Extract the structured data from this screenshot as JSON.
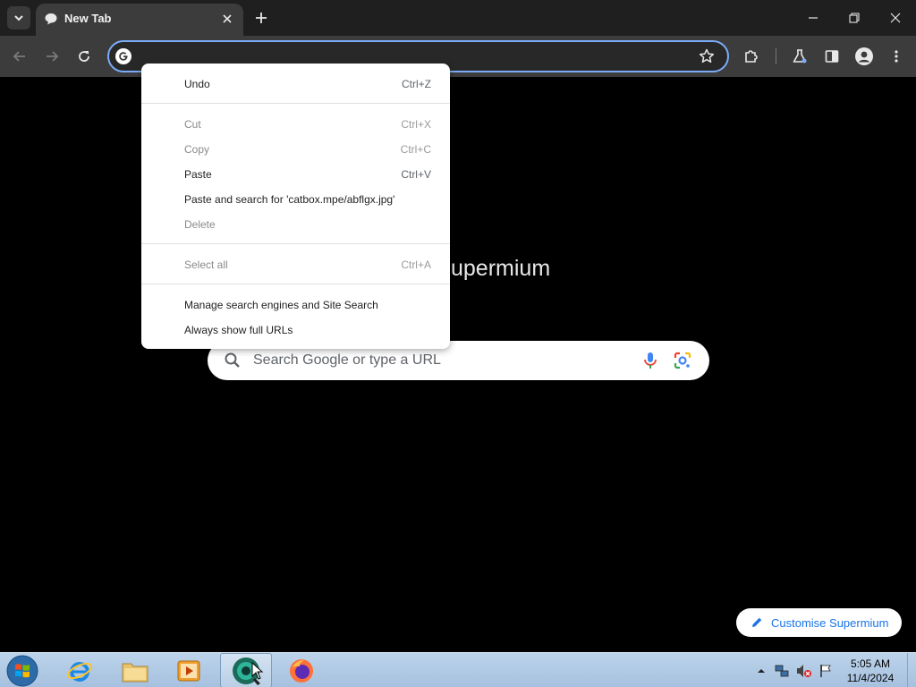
{
  "browser": {
    "tab": {
      "title": "New Tab"
    },
    "omnibox": {
      "value": ""
    }
  },
  "page": {
    "brand_text_visible": "upermium",
    "search": {
      "placeholder": "Search Google or type a URL"
    },
    "customise_label": "Customise Supermium"
  },
  "context_menu": {
    "items": [
      {
        "label": "Undo",
        "accel": "Ctrl+Z",
        "enabled": true
      },
      {
        "label": "Cut",
        "accel": "Ctrl+X",
        "enabled": false
      },
      {
        "label": "Copy",
        "accel": "Ctrl+C",
        "enabled": false
      },
      {
        "label": "Paste",
        "accel": "Ctrl+V",
        "enabled": true
      },
      {
        "label": "Paste and search for 'catbox.mpe/abflgx.jpg'",
        "accel": "",
        "enabled": true
      },
      {
        "label": "Delete",
        "accel": "",
        "enabled": false
      },
      {
        "label": "Select all",
        "accel": "Ctrl+A",
        "enabled": false
      },
      {
        "label": "Manage search engines and Site Search",
        "accel": "",
        "enabled": true
      },
      {
        "label": "Always show full URLs",
        "accel": "",
        "enabled": true
      }
    ]
  },
  "taskbar": {
    "clock": {
      "time": "5:05 AM",
      "date": "11/4/2024"
    },
    "apps": [
      "internet-explorer",
      "file-explorer",
      "media-player",
      "supermium",
      "firefox"
    ]
  },
  "colors": {
    "accent": "#7cacf8",
    "link": "#1a73e8",
    "toolbar": "#3c3c3c",
    "tabstrip": "#1f1f1f"
  }
}
